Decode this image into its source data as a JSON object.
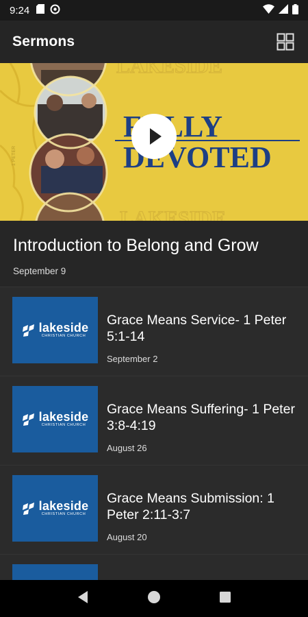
{
  "status_bar": {
    "time": "9:24"
  },
  "app_bar": {
    "title": "Sermons",
    "view_toggle_icon": "grid-view-icon"
  },
  "hero": {
    "artwork_lines": [
      "FULLY",
      "DEVOTED"
    ],
    "play_icon": "play-icon",
    "background_color": "#e8c940",
    "title_color": "#1d3f84"
  },
  "featured": {
    "title": "Introduction to Belong and Grow",
    "date": "September 9"
  },
  "sermons": [
    {
      "title": "Grace Means Service- 1 Peter 5:1-14",
      "date": "September 2"
    },
    {
      "title": "Grace Means Suffering- 1 Peter 3:8-4:19",
      "date": "August 26"
    },
    {
      "title": "Grace Means Submission: 1 Peter 2:11-3:7",
      "date": "August 20"
    },
    {
      "title": "",
      "date": ""
    }
  ],
  "thumbnail": {
    "brand": "lakeside",
    "subtitle": "CHRISTIAN CHURCH",
    "background_color": "#1a5c9e"
  },
  "nav_bar": {
    "back_icon": "back-triangle-icon",
    "home_icon": "home-circle-icon",
    "recents_icon": "recents-square-icon"
  }
}
